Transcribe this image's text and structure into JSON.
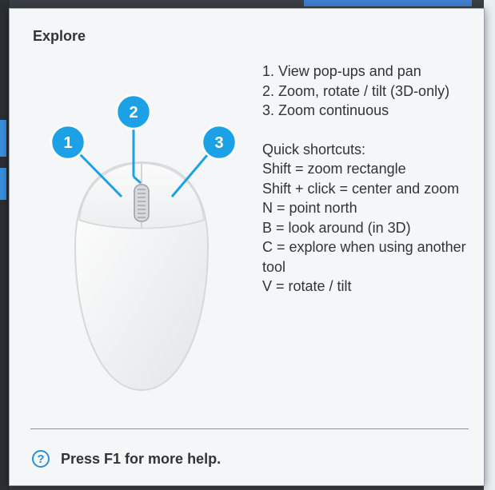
{
  "tooltip": {
    "title": "Explore",
    "mouse_labels": [
      "1",
      "2",
      "3"
    ],
    "instructions": {
      "buttons": [
        "1. View pop-ups and pan",
        "2. Zoom, rotate / tilt (3D-only)",
        "3. Zoom continuous"
      ],
      "shortcuts_heading": "Quick shortcuts:",
      "shortcuts": [
        "Shift = zoom rectangle",
        "Shift + click = center and zoom",
        "N = point north",
        "B = look around (in 3D)",
        "C = explore when using another tool",
        "V = rotate / tilt"
      ]
    },
    "footer": {
      "icon": "help-circle-icon",
      "icon_glyph": "?",
      "text": "Press F1 for more help."
    }
  },
  "colors": {
    "accent": "#2a8fd8",
    "callout": "#1da1e6",
    "panel_bg": "#f5f6f7"
  }
}
